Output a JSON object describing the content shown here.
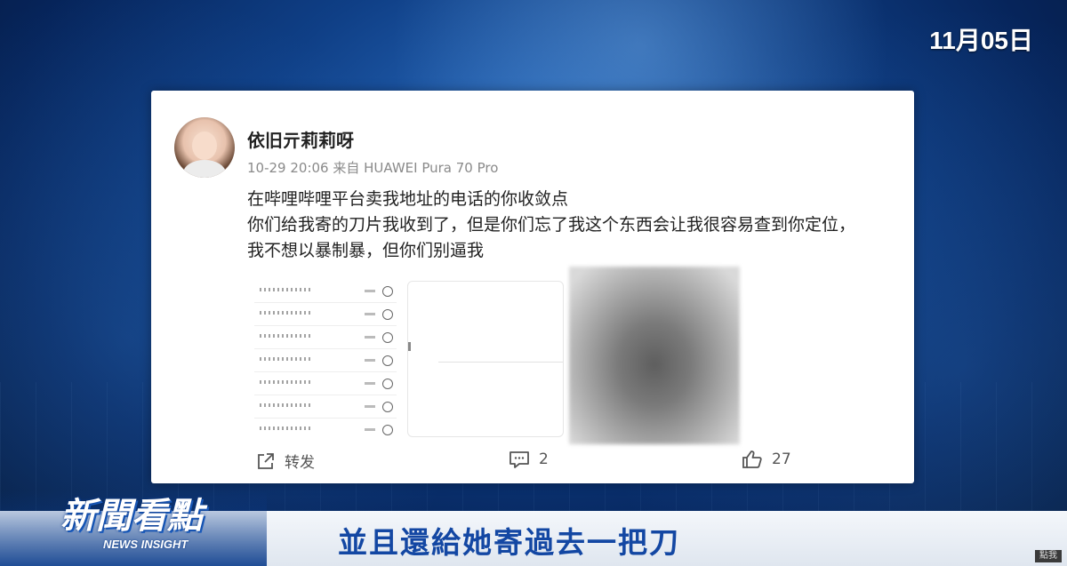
{
  "broadcast": {
    "date": "11月05日",
    "program_logo": "新聞看點",
    "program_logo_en": "NEWS INSIGHT",
    "subtitle": "並且還給她寄過去一把刀",
    "corner_badge": "點我"
  },
  "post": {
    "username": "依旧亓莉莉呀",
    "timestamp": "10-29 20:06",
    "source": "来自 HUAWEI Pura 70 Pro",
    "lines": [
      "在哔哩哔哩平台卖我地址的电话的你收敛点",
      "你们给我寄的刀片我收到了，但是你们忘了我这个东西会让我很容易查到你定位，",
      "我不想以暴制暴，但你们别逼我"
    ],
    "images": [
      "list-screenshot",
      "blank-screenshot",
      "blurred-photo"
    ],
    "actions": {
      "share_label": "转发",
      "comment_count": "2",
      "like_count": "27"
    }
  },
  "colors": {
    "subtitle": "#1347a3",
    "card_bg": "#ffffff",
    "meta_text": "#8a8a8a"
  }
}
